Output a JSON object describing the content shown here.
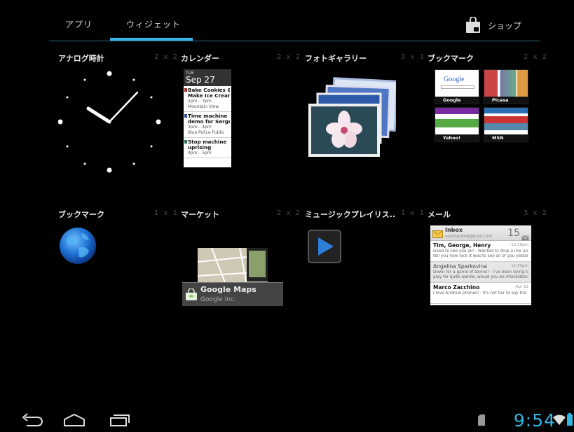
{
  "tabs": {
    "apps": "アプリ",
    "widgets": "ウィジェット",
    "shop": "ショップ"
  },
  "widgets": [
    {
      "title": "アナログ時計",
      "size": "2 x 2"
    },
    {
      "title": "カレンダー",
      "size": "2 x 2"
    },
    {
      "title": "フォトギャラリー",
      "size": "3 x 3"
    },
    {
      "title": "ブックマーク",
      "size": "2 x 2"
    },
    {
      "title": "ブックマーク",
      "size": "1 x 1"
    },
    {
      "title": "マーケット",
      "size": "2 x 2"
    },
    {
      "title": "ミュージックプレイリス...",
      "size": "1 x 1"
    },
    {
      "title": "メール",
      "size": "3 x 2"
    }
  ],
  "calendar": {
    "dow": "TUE",
    "date": "Sep 27",
    "events": [
      {
        "title": "Bake Cookies &",
        "title2": "Make Ice Cream",
        "time": "2pm – 3pm",
        "place": "Mountain View"
      },
      {
        "title": "Time machine",
        "title2": "demo for Serge",
        "time": "3pm – 4pm",
        "place": "Blue Police Public"
      },
      {
        "title": "Stop machine",
        "title2": "uprising",
        "time": "4pm – 5pm",
        "place": ""
      }
    ]
  },
  "bookmarks": [
    "Google",
    "Picasa",
    "Yahoo!",
    "MSN"
  ],
  "google_logo": "Google",
  "market": {
    "app_name": "Google Maps",
    "publisher": "Google Inc."
  },
  "mail": {
    "folder": "Inbox",
    "account": "username@gmail.com",
    "count": "15",
    "messages": [
      {
        "from": "Tim, George, Henry",
        "time": "12:10pm",
        "snippet1": "Good to see you all! · Wanted to drop a line and",
        "snippet2": "tell you how nice it was to see all of you yesterd..."
      },
      {
        "from": "Angelina Sparkovina",
        "time": "11:53pm",
        "snippet1": "Down for a game of tennis? · I've been dying to",
        "snippet2": "play for quite awhile, would you be interested?"
      },
      {
        "from": "Marco Zacchino",
        "time": "Apr 12",
        "snippet1": "I love Android phones! · It's not fair to say the",
        "snippet2": ""
      }
    ]
  },
  "status": {
    "time": "9:54"
  },
  "colors": {
    "accent": "#33b5e5",
    "background": "#000000"
  }
}
